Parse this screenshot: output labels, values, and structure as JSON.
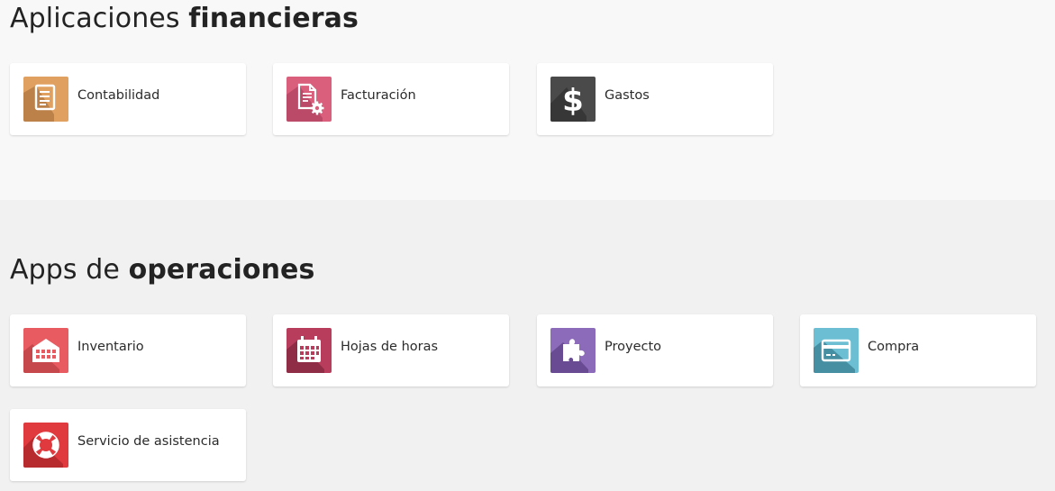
{
  "financial": {
    "title_light": "Aplicaciones",
    "title_bold": "financieras",
    "apps": [
      {
        "label": "Contabilidad",
        "icon": "accounting-document-icon",
        "color": "#e0a060"
      },
      {
        "label": "Facturación",
        "icon": "invoice-gear-icon",
        "color": "#d95f7d"
      },
      {
        "label": "Gastos",
        "icon": "dollar-sign-icon",
        "color": "#4a4a4a"
      }
    ]
  },
  "operations": {
    "title_light": "Apps de",
    "title_bold": "operaciones",
    "apps": [
      {
        "label": "Inventario",
        "icon": "warehouse-icon",
        "color": "#e85c61"
      },
      {
        "label": "Hojas de horas",
        "icon": "calendar-grid-icon",
        "color": "#b83d5c"
      },
      {
        "label": "Proyecto",
        "icon": "puzzle-piece-icon",
        "color": "#8c6cba"
      },
      {
        "label": "Compra",
        "icon": "credit-card-icon",
        "color": "#6cbfd3"
      },
      {
        "label": "Servicio de asistencia",
        "icon": "lifebuoy-icon",
        "color": "#e03a3e"
      }
    ]
  }
}
